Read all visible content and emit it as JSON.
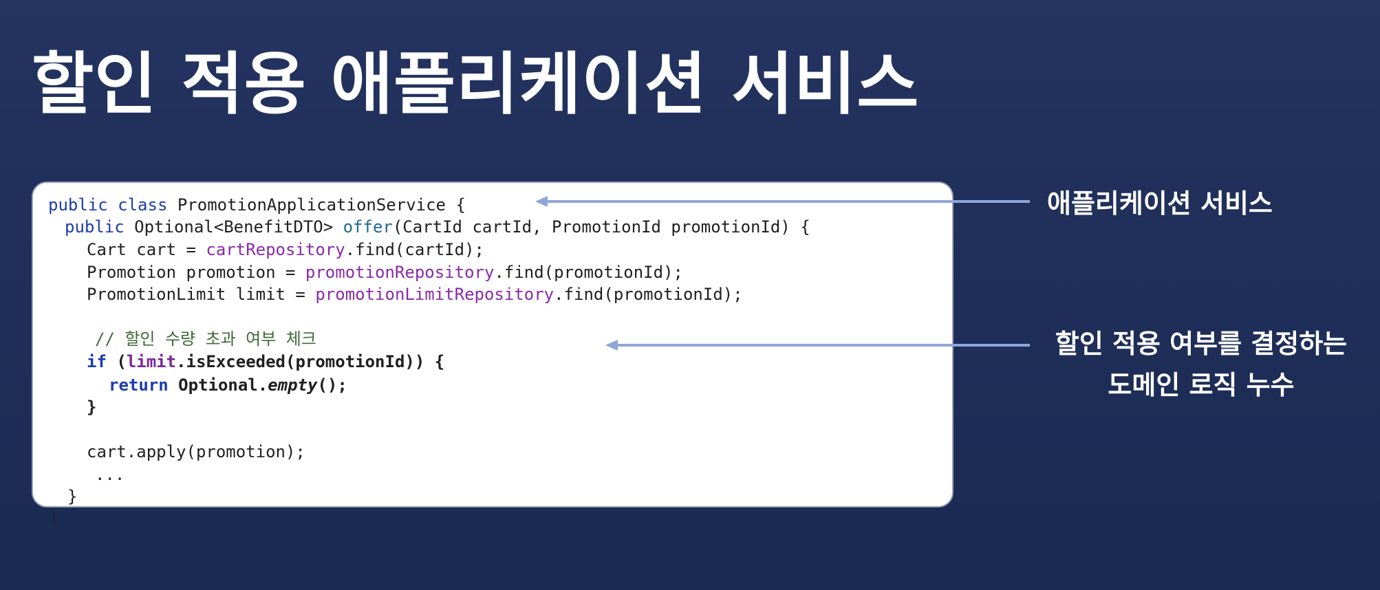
{
  "slide": {
    "title": "할인 적용 애플리케이션 서비스"
  },
  "code": {
    "l1_kw1": "public",
    "l1_kw2": "class",
    "l1_rest": "PromotionApplicationService {",
    "l2_kw": "public",
    "l2_type": "Optional<BenefitDTO>",
    "l2_method": "offer",
    "l2_rest": "(CartId cartId, PromotionId promotionId) {",
    "l3_pre": "Cart cart = ",
    "l3_field": "cartRepository",
    "l3_post": ".find(cartId);",
    "l4_pre": "Promotion promotion = ",
    "l4_field": "promotionRepository",
    "l4_post": ".find(promotionId);",
    "l5_pre": "PromotionLimit limit = ",
    "l5_field": "promotionLimitRepository",
    "l5_post": ".find(promotionId);",
    "l6_comment": "// 할인 수량 초과 여부 체크",
    "l7_kw": "if",
    "l7_paren": "(",
    "l7_field": "limit",
    "l7_post": ".isExceeded(promotionId)) {",
    "l8_kw": "return",
    "l8_pre": "Optional.",
    "l8_italic": "empty",
    "l8_post": "();",
    "l9_brace": "}",
    "l10_text": "cart.apply(promotion);",
    "l11_text": "...",
    "l12_brace": "}",
    "outer_brace": "}"
  },
  "annotations": {
    "service_label": "애플리케이션 서비스",
    "domain_logic_line1": "할인 적용 여부를 결정하는",
    "domain_logic_line2": "도메인 로직 누수"
  },
  "colors": {
    "arrow": "#8fa6d8",
    "background": "#213160",
    "keyword": "#1c3bb0",
    "field": "#8a2aa8",
    "comment": "#3f6a37"
  }
}
